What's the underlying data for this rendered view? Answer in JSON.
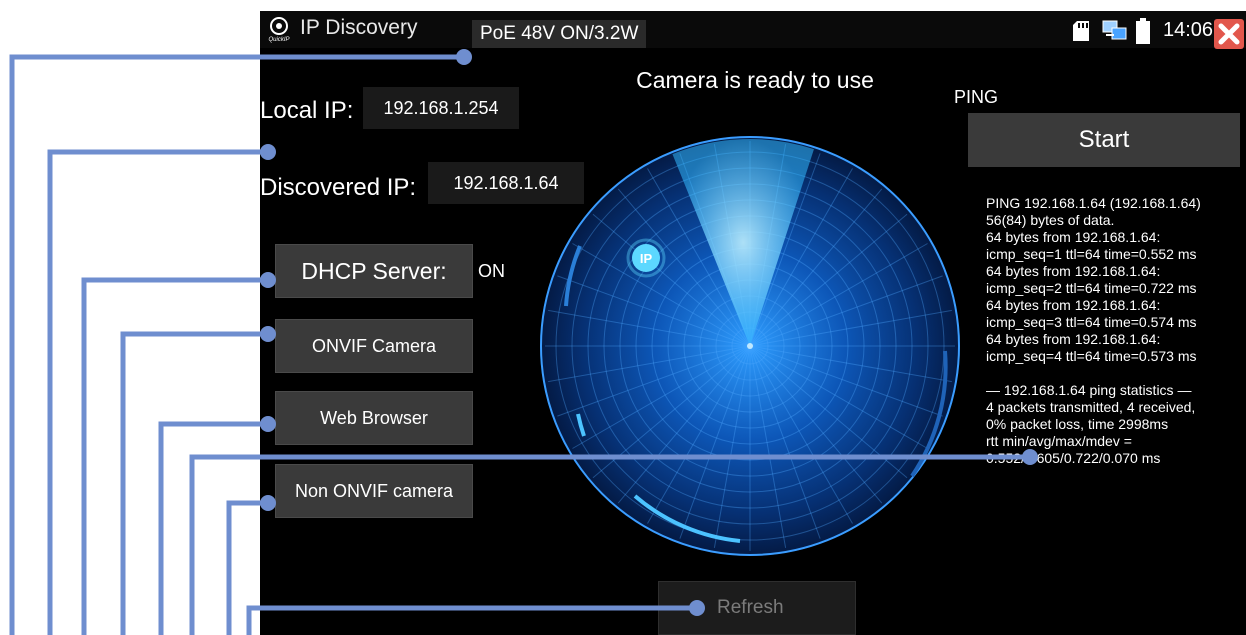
{
  "app": {
    "title": "IP Discovery",
    "logo_caption": "QuickIP",
    "poe_status": "PoE 48V ON/3.2W",
    "clock": "14:06"
  },
  "status_message": "Camera is ready to use",
  "local_ip": {
    "label": "Local IP:",
    "value": "192.168.1.254"
  },
  "discovered_ip": {
    "label": "Discovered IP:",
    "value": "192.168.1.64"
  },
  "buttons": {
    "dhcp": "DHCP Server:",
    "dhcp_state": "ON",
    "onvif": "ONVIF Camera",
    "web": "Web Browser",
    "non_onvif": "Non ONVIF camera",
    "refresh": "Refresh"
  },
  "radar": {
    "marker": "IP"
  },
  "ping": {
    "label": "PING",
    "start_label": "Start",
    "output": "PING 192.168.1.64 (192.168.1.64)\n56(84) bytes of data.\n64 bytes from 192.168.1.64:\nicmp_seq=1 ttl=64 time=0.552 ms\n64 bytes from 192.168.1.64:\nicmp_seq=2 ttl=64 time=0.722 ms\n64 bytes from 192.168.1.64:\nicmp_seq=3 ttl=64 time=0.574 ms\n64 bytes from 192.168.1.64:\nicmp_seq=4 ttl=64 time=0.573 ms\n\n— 192.168.1.64 ping statistics —\n4 packets transmitted, 4 received,\n0% packet loss, time 2998ms\nrtt min/avg/max/mdev =\n0.552/0.605/0.722/0.070 ms"
  },
  "colors": {
    "annotation_line": "#6f8ecf",
    "close_button": "#e2574c",
    "radar_glow": "#1f8fff",
    "radar_sweep": "#62c8ff"
  },
  "icons": {
    "logo": "quickip-logo-icon",
    "sd_card": "sd-card-icon",
    "network": "network-icon",
    "battery": "battery-icon",
    "close": "close-icon"
  }
}
